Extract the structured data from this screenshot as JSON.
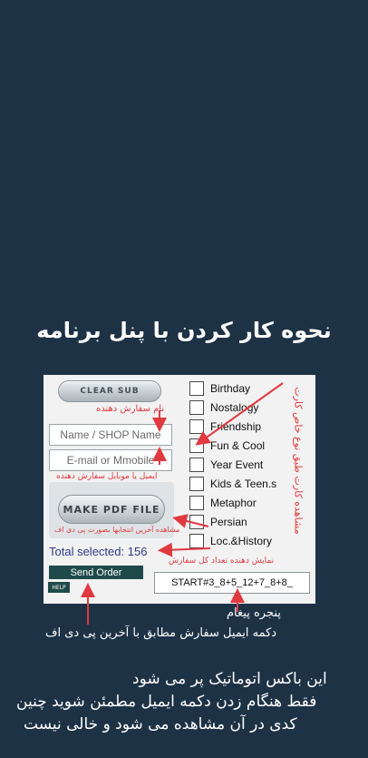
{
  "heading": "نحوه کار کردن  با پنل برنامه",
  "panel": {
    "clear_button": "CLEAR SUB",
    "name_hint": "نام سفارش دهنده",
    "name_placeholder": "Name / SHOP Name",
    "email_placeholder": "E-mail or Mmobile",
    "email_hint": "ایمیل یا موبایل سفارش دهنده",
    "pdf_button": "MAKE PDF FILE",
    "pdf_hint": "مشاهده آخرین انتخابها بصورت پی دی اف",
    "total_label": "Total selected:",
    "total_value": "156",
    "total_hint": "نمایش دهنده تعداد کل سفارش",
    "send_button": "Send Order",
    "help_button": "HELP",
    "side_note": "مشاهده کارت طبق نوع خاص کارت",
    "code_value": "START#3_8+5_12+7_8+8_",
    "categories": [
      {
        "label": "Birthday"
      },
      {
        "label": "Nostalogy"
      },
      {
        "label": "Friendship"
      },
      {
        "label": "Fun & Cool"
      },
      {
        "label": "Year Event"
      },
      {
        "label": "Kids & Teen.s"
      },
      {
        "label": "Metaphor"
      },
      {
        "label": "Persian"
      },
      {
        "label": "Loc.&History"
      }
    ]
  },
  "captions": {
    "message_window": "پنجره  پیغام",
    "send_desc": "دکمه ایمیل سفارش مطابق با آخرین پی دی اف",
    "line1": "این باکس اتوماتیک پر می شود",
    "line2": "فقط هنگام  زدن  دکمه ایمیل مطمئن شوید  چنین",
    "line3": "کدی در آن مشاهده می شود و خالی نیست"
  }
}
